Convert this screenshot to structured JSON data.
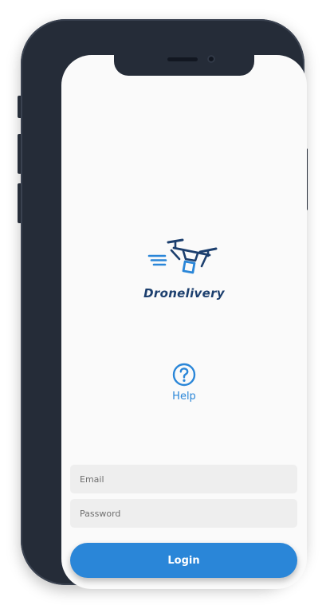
{
  "app": {
    "name": "Dronelivery",
    "logo_icon": "drone-delivery-icon"
  },
  "help": {
    "label": "Help",
    "icon": "question-circle-icon"
  },
  "form": {
    "email_placeholder": "Email",
    "email_value": "",
    "password_placeholder": "Password",
    "password_value": "",
    "login_label": "Login"
  },
  "colors": {
    "accent": "#2a86d8",
    "brand_dark": "#1c3f6e",
    "device_frame": "#252c38",
    "screen_bg": "#fafafa",
    "field_bg": "#eeeeee"
  }
}
